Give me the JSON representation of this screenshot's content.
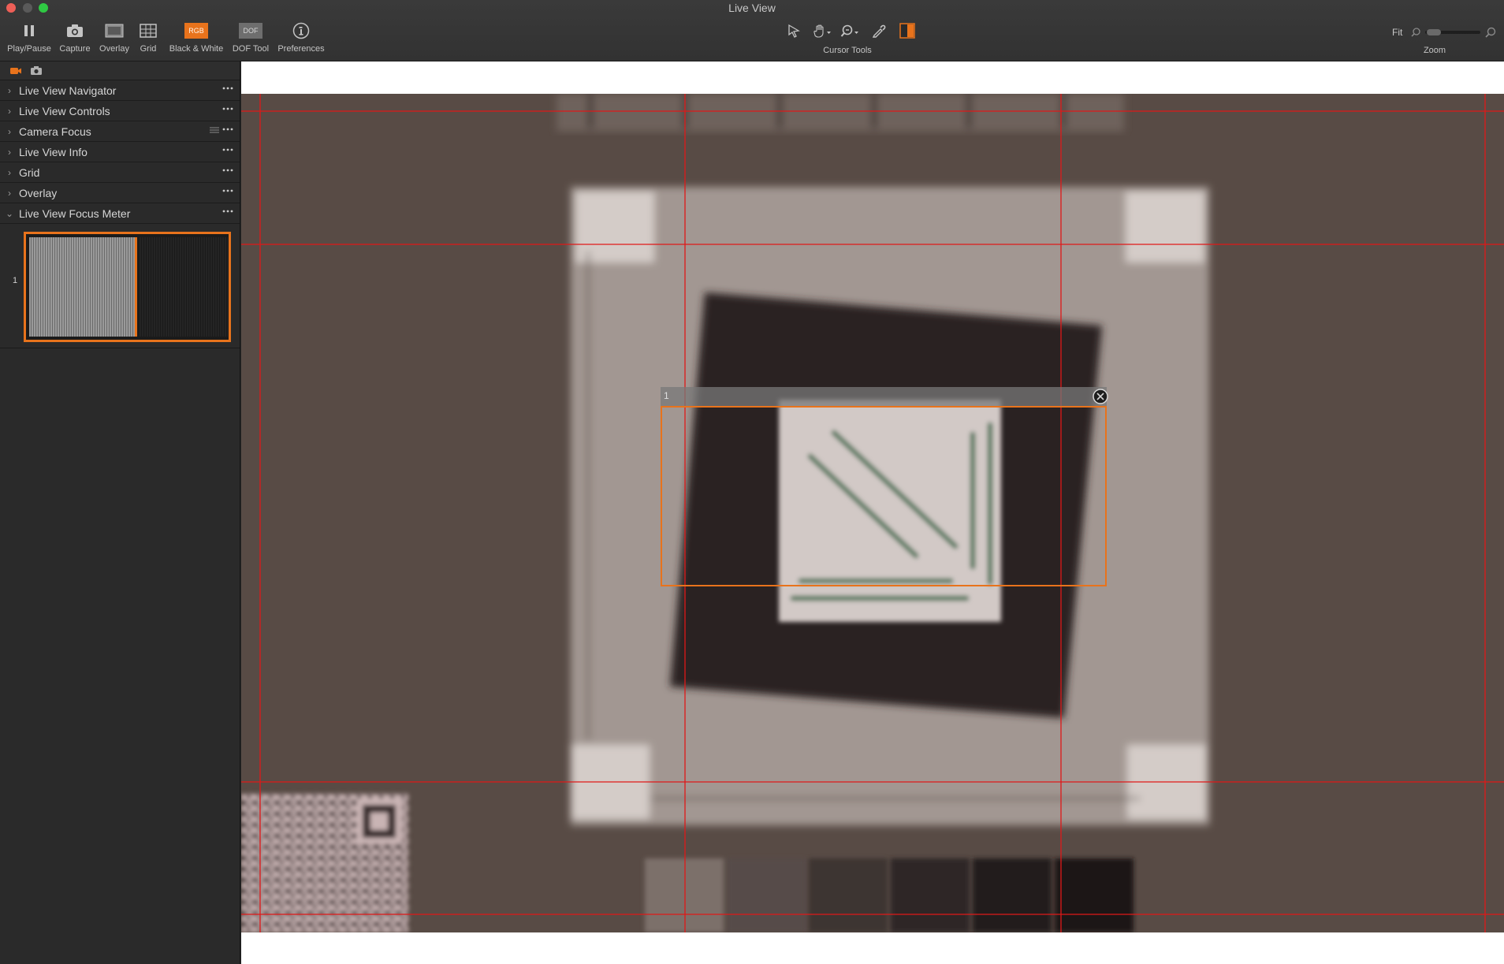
{
  "window": {
    "title": "Live View"
  },
  "toolbar": {
    "play_pause": "Play/Pause",
    "capture": "Capture",
    "overlay": "Overlay",
    "grid": "Grid",
    "black_white": "Black & White",
    "black_white_badge": "RGB",
    "dof_tool": "DOF Tool",
    "dof_badge": "DOF",
    "preferences": "Preferences",
    "cursor_tools": "Cursor Tools",
    "fit": "Fit",
    "zoom": "Zoom"
  },
  "sidebar": {
    "items": [
      {
        "label": "Live View Navigator"
      },
      {
        "label": "Live View Controls"
      },
      {
        "label": "Camera Focus"
      },
      {
        "label": "Live View Info"
      },
      {
        "label": "Grid"
      },
      {
        "label": "Overlay"
      },
      {
        "label": "Live View Focus Meter"
      }
    ],
    "focus_meter": {
      "index": "1",
      "level": 0.54
    }
  },
  "view": {
    "focus_box": {
      "label": "1"
    },
    "grid_color": "#e01818",
    "accent": "#e8731c"
  }
}
